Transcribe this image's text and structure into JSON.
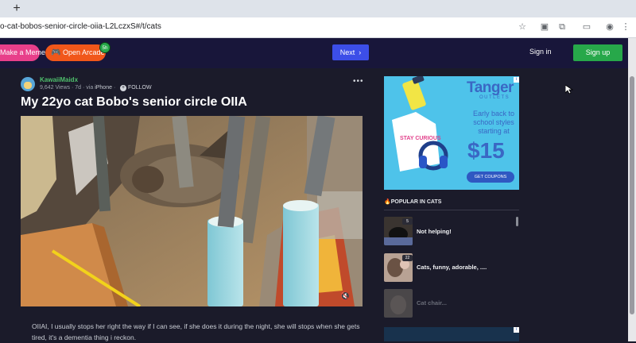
{
  "browser": {
    "url": "o-cat-bobos-senior-circle-oiia-L2LczxS#/t/cats",
    "new_tab_symbol": "+"
  },
  "header": {
    "make_meme_label": "Make a Meme",
    "open_arcade_label": "Open Arcade",
    "arcade_badge": "5h",
    "next_label": "Next",
    "sign_in_label": "Sign in",
    "sign_up_label": "Sign up"
  },
  "post": {
    "username": "KawaiiMaidx",
    "views": "9,642 Views",
    "age": "7d",
    "via_label": "via",
    "device": "iPhone",
    "follow_label": "FOLLOW",
    "title": "My 22yo cat Bobo's senior circle OIIA",
    "caption": "OIIAI, I usually stops her right the way if I can see, if she does it during the night, she will stops when she gets tired, it's a dementia thing i reckon."
  },
  "ad": {
    "brand": "Tanger",
    "subbrand": "OUTLETS",
    "tagline": "Early back to school styles starting at",
    "price": "$15",
    "cta": "GET COUPONS",
    "shirt_text": "STAY CURIOUS"
  },
  "popular": {
    "heading": "POPULAR IN CATS",
    "items": [
      {
        "title": "Not helping!",
        "count": "5"
      },
      {
        "title": "Cats, funny, adorable, ....",
        "count": "22"
      },
      {
        "title": "Cat chair..."
      }
    ]
  },
  "colors": {
    "accent_green": "#27a84a",
    "next_blue": "#3c4ee8",
    "meme_pink": "#e83f8a",
    "arcade_orange": "#f1571a"
  }
}
